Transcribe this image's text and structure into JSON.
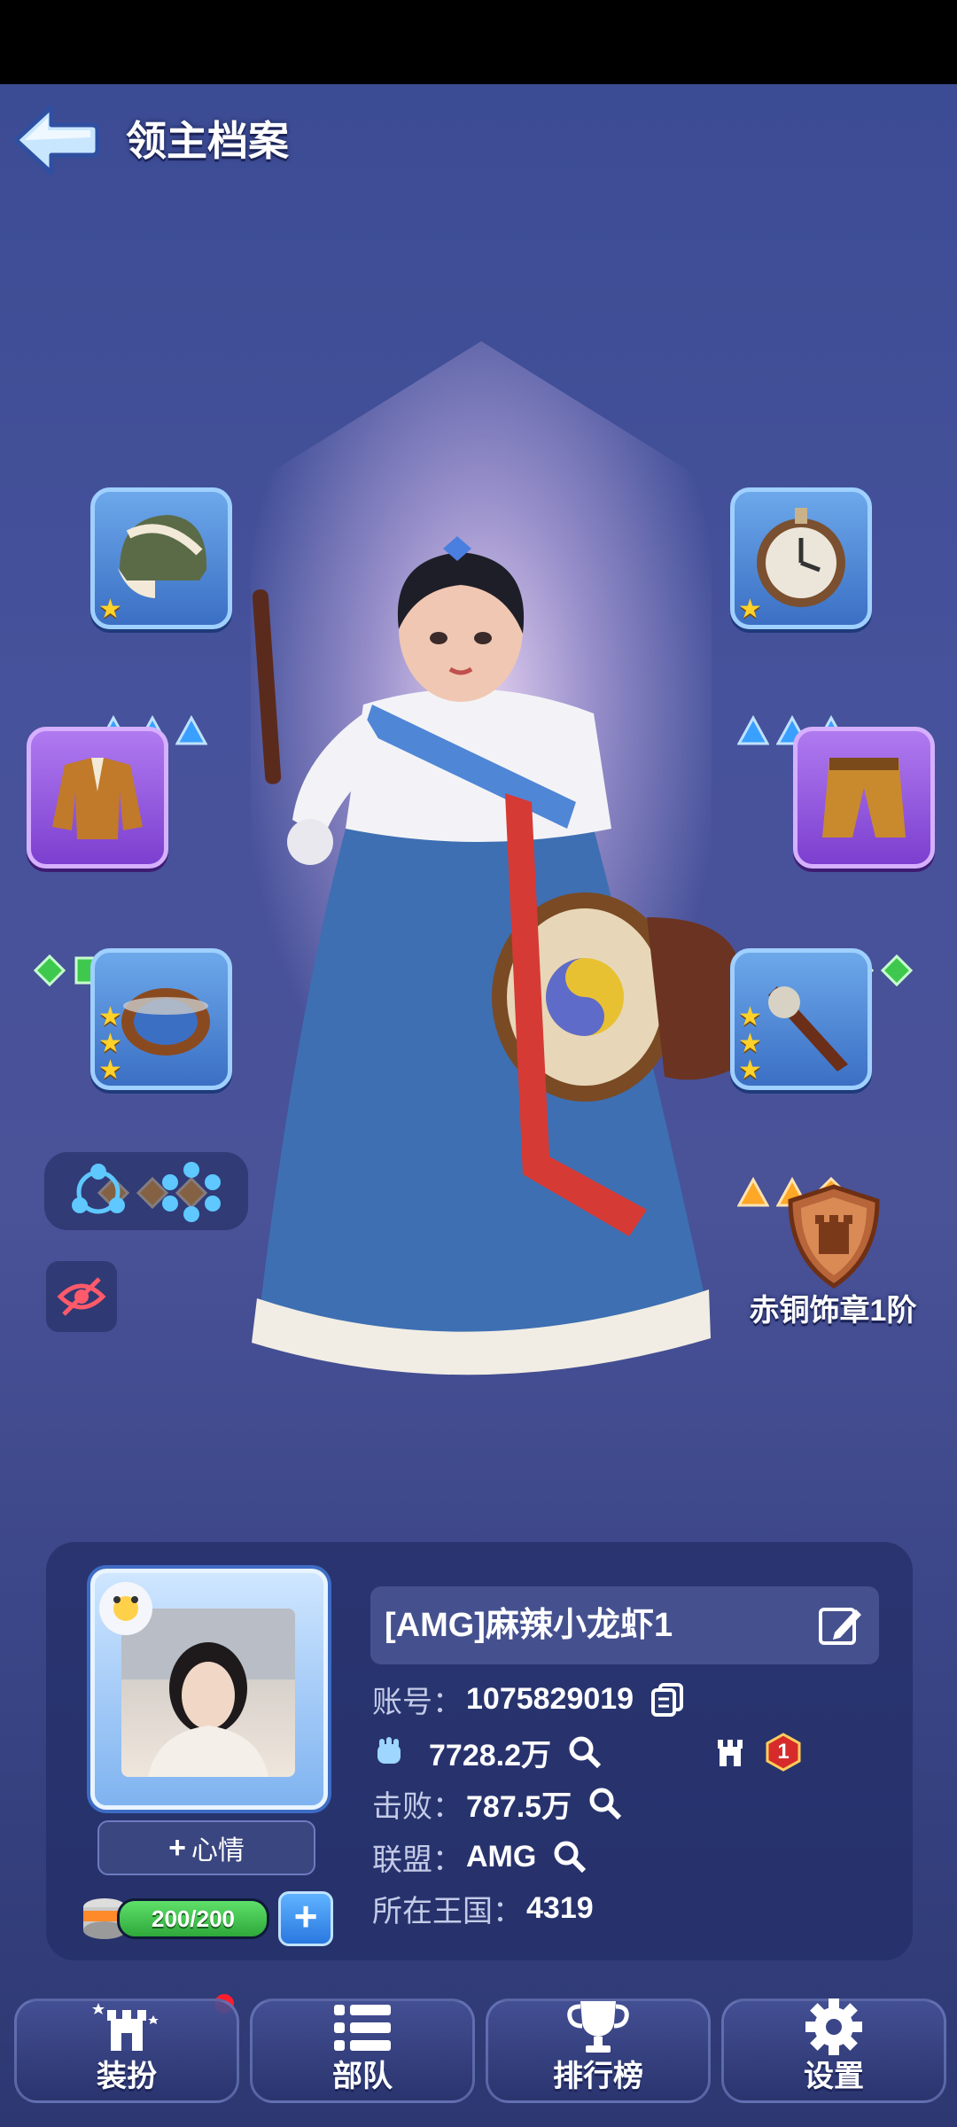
{
  "header": {
    "title": "领主档案"
  },
  "badge": {
    "label": "赤铜饰章1阶"
  },
  "profile": {
    "name": "[AMG]麻辣小龙虾1",
    "account_label": "账号：",
    "account_value": "1075829019",
    "power_value": "7728.2万",
    "kills_label": "击败：",
    "kills_value": "787.5万",
    "alliance_label": "联盟：",
    "alliance_value": "AMG",
    "kingdom_label": "所在王国：",
    "kingdom_value": "4319",
    "mood_label": "心情",
    "stamina_text": "200/200",
    "stamina_fraction": 1.0,
    "rank_badge": "1"
  },
  "equipment": {
    "helmet": {
      "stars": 1,
      "gem_color": "#3aa0ff"
    },
    "pocket_watch": {
      "stars": 1,
      "gem_color": "#3aa0ff"
    },
    "jacket": {
      "stars": 0,
      "gem_color": "#3ec94e"
    },
    "pants": {
      "stars": 0,
      "gem_color": "#3ec94e"
    },
    "ring": {
      "stars": 3,
      "gem_color": "#ffa726"
    },
    "weapon": {
      "stars": 3,
      "gem_color": "#ffa726"
    }
  },
  "nav": {
    "dress": "装扮",
    "troops": "部队",
    "ranking": "排行榜",
    "settings": "设置"
  },
  "colors": {
    "accent_blue": "#3b6fc4",
    "epic_purple": "#7c3fcf",
    "bronze": "#b8653a",
    "notify_red": "#ff1d2c"
  }
}
